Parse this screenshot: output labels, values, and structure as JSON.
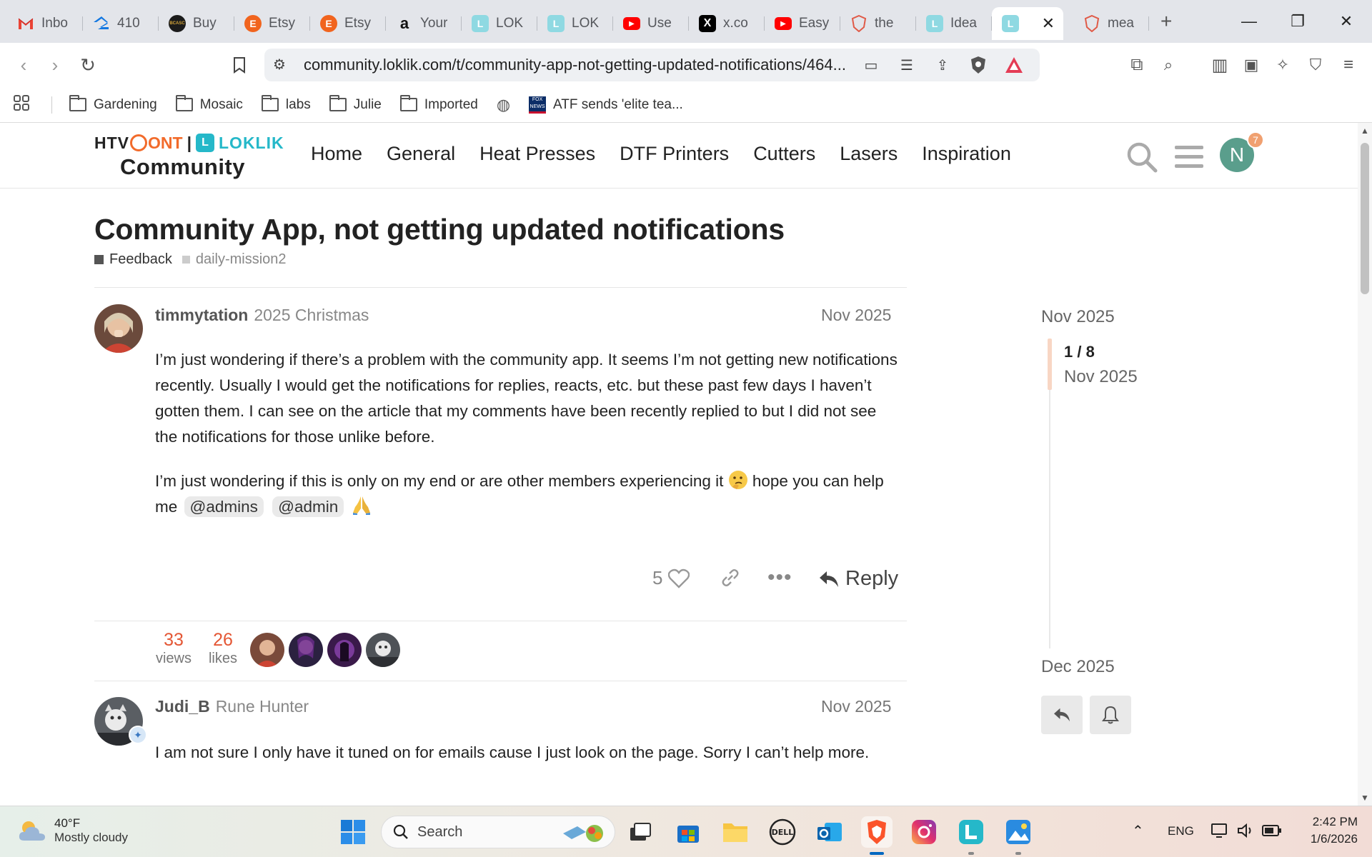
{
  "browser": {
    "tabs": [
      {
        "label": "Inbo",
        "icon": "gmail-icon"
      },
      {
        "label": "410",
        "icon": "zillow-icon"
      },
      {
        "label": "Buy",
        "icon": "bcasc-icon"
      },
      {
        "label": "Etsy",
        "icon": "etsy-icon"
      },
      {
        "label": "Etsy",
        "icon": "etsy-icon"
      },
      {
        "label": "Your",
        "icon": "amazon-icon"
      },
      {
        "label": "LOK",
        "icon": "loklik-icon"
      },
      {
        "label": "LOK",
        "icon": "loklik-icon"
      },
      {
        "label": "Use",
        "icon": "youtube-icon"
      },
      {
        "label": "x.co",
        "icon": "x-icon"
      },
      {
        "label": "Easy",
        "icon": "youtube-icon"
      },
      {
        "label": "the",
        "icon": "brave-shield-icon"
      },
      {
        "label": "Idea",
        "icon": "loklik-icon"
      },
      {
        "label": "",
        "icon": "loklik-icon"
      },
      {
        "label": "mea",
        "icon": "brave-shield-icon"
      }
    ],
    "url": "community.loklik.com/t/community-app-not-getting-updated-notifications/464...",
    "bookmarks": [
      "Gardening",
      "Mosaic",
      "labs",
      "Julie",
      "Imported"
    ],
    "bookmark_news": "ATF sends 'elite tea...",
    "bookmark_news_badge": "FOX NEWS"
  },
  "site": {
    "logo_top_left": "HTV",
    "logo_top_mid": "ONT",
    "logo_top_sep": "|",
    "logo_top_right": "LOKLIK",
    "logo_bottom": "Community",
    "nav": [
      "Home",
      "General",
      "Heat Presses",
      "DTF Printers",
      "Cutters",
      "Lasers",
      "Inspiration"
    ],
    "user_initial": "N",
    "notification_count": "7"
  },
  "topic": {
    "title": "Community App, not getting updated notifications",
    "category": "Feedback",
    "category_color": "#555555",
    "tag": "daily-mission2",
    "posts": [
      {
        "username": "timmytation",
        "user_title": "2025 Christmas",
        "date": "Nov 2025",
        "p1": "I’m just wondering if there’s a problem with the community app. It seems I’m not getting new notifications recently. Usually I would get the notifications for replies, reacts, etc. but these past few days I haven’t gotten them. I can see on the article that my comments have been recently replied to but I did not see the notifications for those unlike before.",
        "p2_start": "I’m just wondering if this is only on my end or are other members experiencing it",
        "p2_mid": "hope you can help me",
        "mention1": "@admins",
        "mention2": "@admin",
        "likes": "5",
        "reply_label": "Reply"
      },
      {
        "username": "Judi_B",
        "user_title": "Rune Hunter",
        "date": "Nov 2025",
        "text": "I am not sure I only have it tuned on for emails cause I just look on the page. Sorry I can’t help more."
      }
    ],
    "views": "33",
    "views_label": "views",
    "likes": "26",
    "likes_label": "likes"
  },
  "timeline": {
    "start_date": "Nov 2025",
    "position": "1 / 8",
    "position_date": "Nov 2025",
    "end_date": "Dec 2025"
  },
  "taskbar": {
    "temp": "40°F",
    "weather": "Mostly cloudy",
    "search_placeholder": "Search",
    "lang": "ENG",
    "time": "2:42 PM",
    "date": "1/6/2026"
  },
  "colors": {
    "accent": "#e45735",
    "loklik_teal": "#25b8c9"
  }
}
